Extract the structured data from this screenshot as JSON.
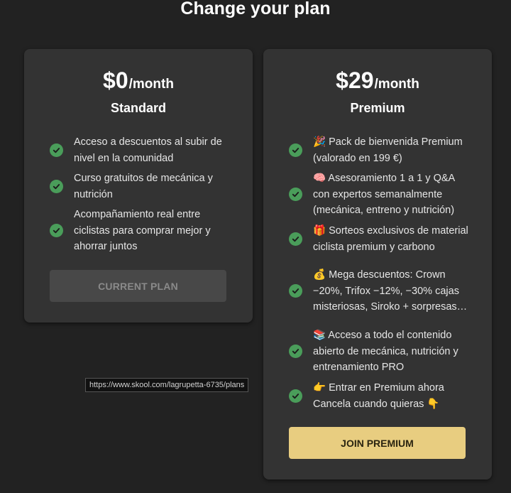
{
  "page": {
    "title": "Change your plan"
  },
  "plans": [
    {
      "price": "$0",
      "period": "/month",
      "name": "Standard",
      "features": [
        "Acceso a descuentos al subir de nivel en la comunidad",
        "Curso gratuitos de mecánica y nutrición",
        "Acompañamiento real entre ciclistas para comprar mejor y ahorrar juntos"
      ],
      "button_label": "CURRENT PLAN"
    },
    {
      "price": "$29",
      "period": "/month",
      "name": "Premium",
      "features": [
        "🎉 Pack de bienvenida Premium (valorado en 199 €)",
        "🧠 Asesoramiento 1 a 1 y Q&A con expertos semanalmente (mecánica, entreno y nutrición)",
        "🎁 Sorteos exclusivos de material ciclista premium y carbono",
        "💰 Mega descuentos: Crown −20%, Trifox −12%, −30% cajas misteriosas, Siroko + sorpresas…",
        "📚 Acceso a todo el contenido abierto de mecánica, nutrición y entrenamiento PRO",
        "👉 Entrar en Premium ahora Cancela cuando quieras 👇"
      ],
      "button_label": "JOIN PREMIUM"
    }
  ],
  "tooltip": {
    "url": "https://www.skool.com/lagrupetta-6735/plans"
  },
  "colors": {
    "background": "#222222",
    "card": "#333333",
    "check": "#4a9d5a",
    "join_button": "#e8cd80",
    "current_button": "#484848"
  }
}
